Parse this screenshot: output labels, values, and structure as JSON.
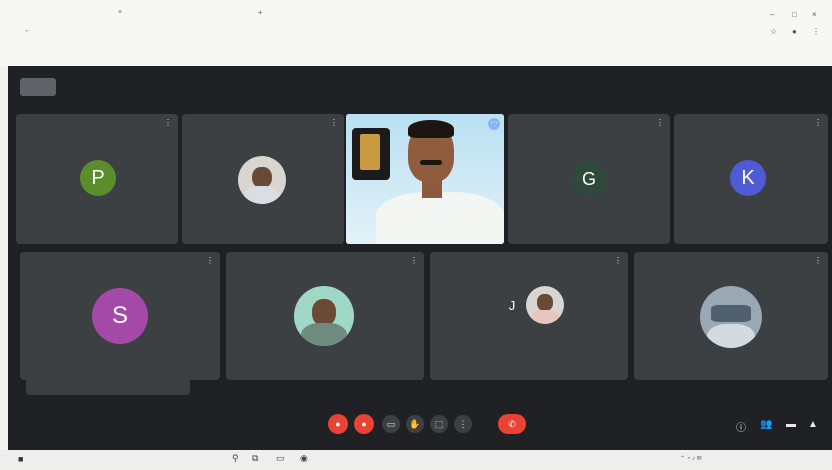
{
  "browser": {
    "tab_title": "",
    "url": "",
    "bookmarks": ""
  },
  "meet": {
    "top_button": "",
    "tiles": [
      {
        "initial": "P",
        "avatar_color": "#5b8d2d",
        "name": ""
      },
      {
        "initial": "",
        "name": ""
      },
      {
        "initial": "",
        "name": ""
      },
      {
        "initial": "G",
        "avatar_color": "#2e4a3b",
        "name": ""
      },
      {
        "initial": "K",
        "avatar_color": "#4f5bd5",
        "name": ""
      },
      {
        "initial": "S",
        "avatar_color": "#a449a8",
        "name": ""
      },
      {
        "initial": "",
        "name": ""
      },
      {
        "initial": "J",
        "name": ""
      },
      {
        "initial": "",
        "name": ""
      }
    ],
    "toast": "",
    "meeting_time": "",
    "leave_label": ""
  },
  "colors": {
    "meet_background": "#202124",
    "tile_background": "#3c4043",
    "danger": "#ea4335"
  },
  "taskbar": {
    "search_placeholder": "",
    "clock": ""
  }
}
